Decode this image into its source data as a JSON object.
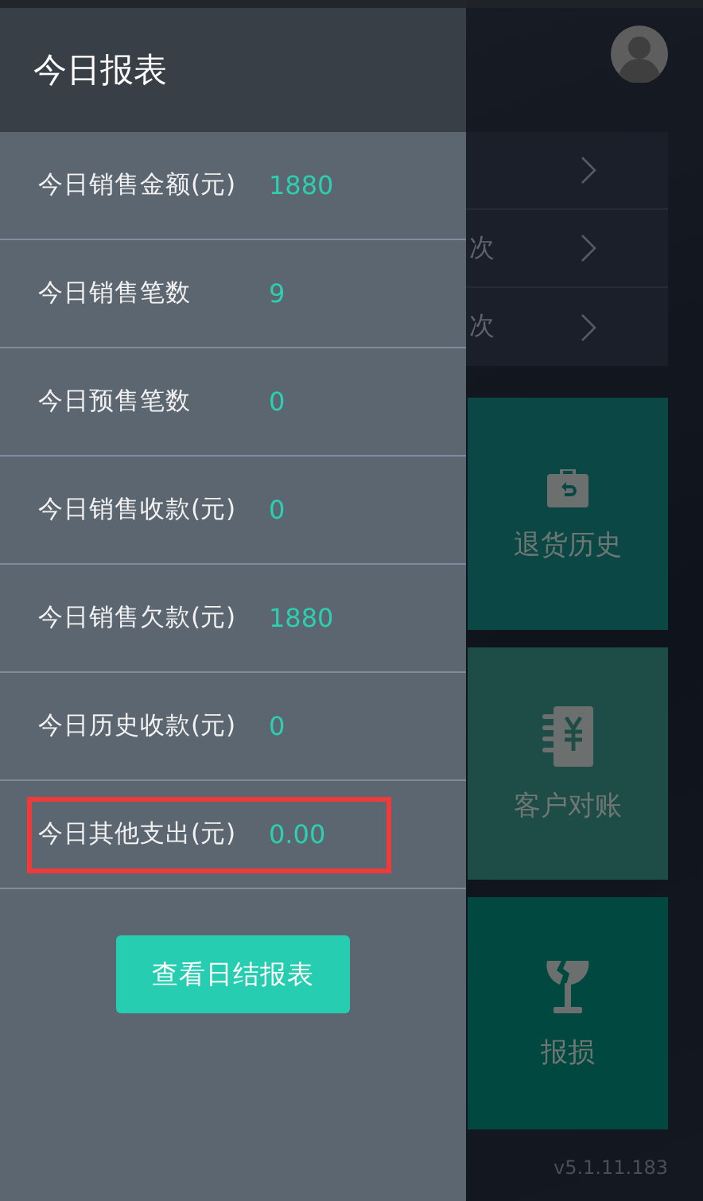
{
  "drawer": {
    "title": "今日报表",
    "rows": [
      {
        "label": "今日销售金额(元)",
        "value": "1880",
        "highlighted": false
      },
      {
        "label": "今日销售笔数",
        "value": "9",
        "highlighted": false
      },
      {
        "label": "今日预售笔数",
        "value": "0",
        "highlighted": false
      },
      {
        "label": "今日销售收款(元)",
        "value": "0",
        "highlighted": false
      },
      {
        "label": "今日销售欠款(元)",
        "value": "1880",
        "highlighted": false
      },
      {
        "label": "今日历史收款(元)",
        "value": "0",
        "highlighted": false
      },
      {
        "label": "今日其他支出(元)",
        "value": "0.00",
        "highlighted": true
      }
    ],
    "button": "查看日结报表"
  },
  "background": {
    "list_rows": [
      {
        "text": ""
      },
      {
        "text": "次"
      },
      {
        "text": "次"
      }
    ],
    "tiles": [
      {
        "kind": "return",
        "label": "退货历史",
        "color": "#0b4845"
      },
      {
        "kind": "ledger",
        "label": "客户对账",
        "color": "#1e4d47"
      },
      {
        "kind": "breakage",
        "label": "报损",
        "color": "#004840"
      }
    ],
    "version": "v5.1.11.183"
  }
}
